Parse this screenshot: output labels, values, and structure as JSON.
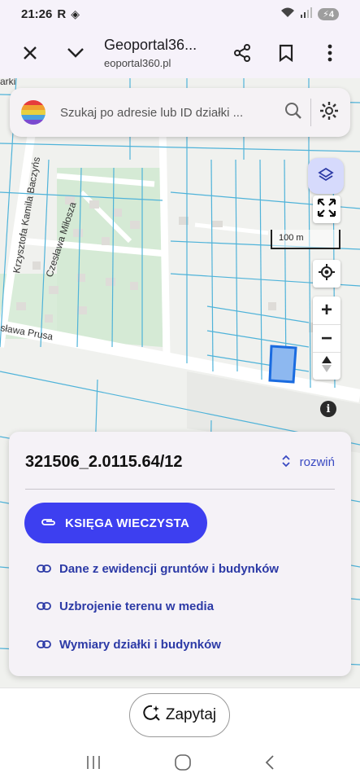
{
  "status": {
    "time": "21:26",
    "carrier_letter": "R",
    "battery": "4"
  },
  "browser": {
    "page_title": "Geoportal36...",
    "url": "eoportal360.pl"
  },
  "search": {
    "placeholder": "Szukaj po adresie lub ID działki ..."
  },
  "map": {
    "scale_label": "100 m",
    "street_labels": [
      "Krzysztofa Kamila Baczyńs",
      "Czesława Miłosza",
      "sława Prusa",
      "arki"
    ]
  },
  "card": {
    "parcel_id": "321506_2.0115.64/12",
    "expand_label": "rozwiń",
    "primary_button": "KSIĘGA WIECZYSTA",
    "links": [
      "Dane z ewidencji gruntów i budynków",
      "Uzbrojenie terenu w media",
      "Wymiary działki i budynków"
    ]
  },
  "ask_button": "Zapytaj",
  "colors": {
    "accent": "#3d3ff0",
    "link": "#2c3aa6",
    "parcel_fill": "#8db8f0",
    "parcel_border": "#1a6be0",
    "boundaries": "#4fb3d9"
  }
}
